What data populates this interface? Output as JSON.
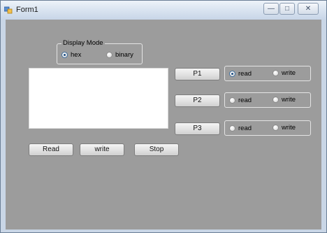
{
  "window": {
    "title": "Form1",
    "controls": {
      "minimize": "—",
      "maximize": "□",
      "close": "✕"
    }
  },
  "display_mode": {
    "group_label": "Display Mode",
    "options": [
      {
        "label": "hex",
        "checked": true
      },
      {
        "label": "binary",
        "checked": false
      }
    ]
  },
  "port_buttons": [
    {
      "label": "P1",
      "options": [
        {
          "label": "read",
          "checked": true
        },
        {
          "label": "write",
          "checked": false
        }
      ]
    },
    {
      "label": "P2",
      "options": [
        {
          "label": "read",
          "checked": false
        },
        {
          "label": "write",
          "checked": false
        }
      ]
    },
    {
      "label": "P3",
      "options": [
        {
          "label": "read",
          "checked": false
        },
        {
          "label": "write",
          "checked": false
        }
      ]
    }
  ],
  "actions": {
    "read_label": "Read",
    "write_label": "write",
    "stop_label": "Stop"
  },
  "output_box": {
    "value": ""
  }
}
